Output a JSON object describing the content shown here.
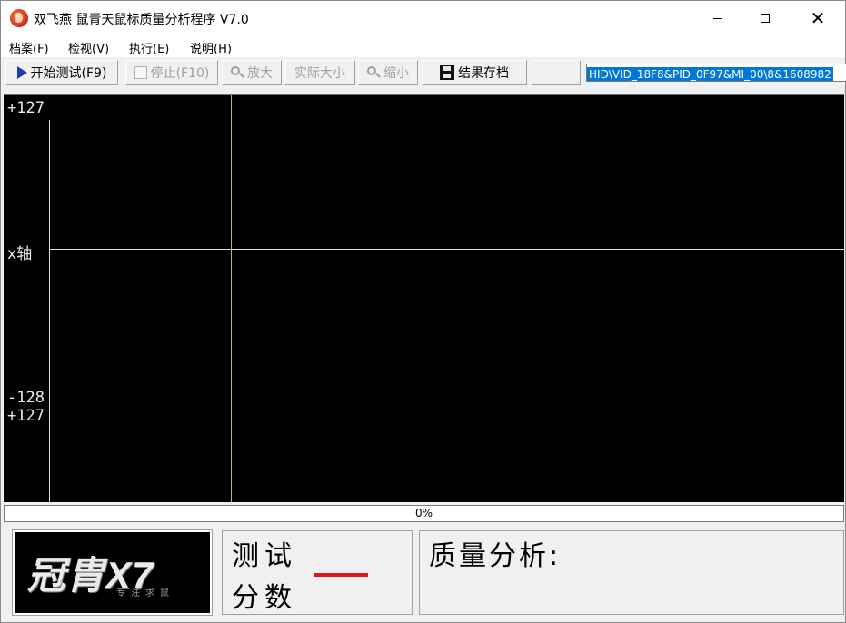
{
  "window": {
    "title": "双飞燕 鼠青天鼠标质量分析程序 V7.0",
    "close_symbol": "✕"
  },
  "menu": {
    "items": [
      "档案(F)",
      "检视(V)",
      "执行(E)",
      "说明(H)"
    ]
  },
  "toolbar": {
    "start_label": "开始测试(F9)",
    "stop_label": "停止(F10)",
    "zoom_in_label": "放大",
    "actual_size_label": "实际大小",
    "zoom_out_label": "缩小",
    "save_label": "结果存档",
    "device_id": "HID\\VID_18F8&PID_0F97&MI_00\\8&1608982"
  },
  "plot": {
    "top_max_label": "+127",
    "axis_label": "x轴",
    "top_min_label": "-128",
    "bottom_max_label": "+127",
    "axis_color": "#e0e0e0",
    "cursor_color": "#c9b25a"
  },
  "progress": {
    "value": 0,
    "text": "0%"
  },
  "logo": {
    "brand": "冠胄X7",
    "slogan": "专注求鼠"
  },
  "score": {
    "label_line1": "测试",
    "label_line2": "分数",
    "value_color": "#e0151b"
  },
  "quality": {
    "label": "质量分析:"
  }
}
